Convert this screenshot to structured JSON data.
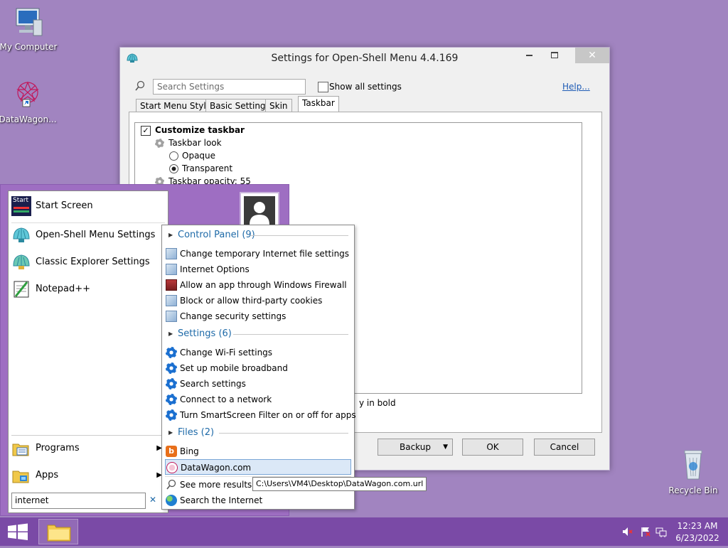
{
  "desktop": {
    "icons": [
      {
        "label": "My Computer"
      },
      {
        "label": "DataWagon..."
      },
      {
        "label": "Recycle Bin"
      }
    ]
  },
  "settings_window": {
    "title": "Settings for Open-Shell Menu 4.4.169",
    "controls": {
      "minimize": "▭",
      "maximize": "☐",
      "close": "✕"
    },
    "search_placeholder": "Search Settings",
    "show_all_label": "Show all settings",
    "help_link": "Help...",
    "tabs": [
      {
        "label": "Start Menu Style"
      },
      {
        "label": "Basic Settings"
      },
      {
        "label": "Skin"
      },
      {
        "label": "Taskbar",
        "active": true
      }
    ],
    "options": {
      "customize_taskbar": "Customize taskbar",
      "taskbar_look": "Taskbar look",
      "opaque": "Opaque",
      "transparent": "Transparent",
      "taskbar_opacity": "Taskbar opacity: 55"
    },
    "bold_note_fragment": "y in bold",
    "buttons": {
      "backup": "Backup",
      "ok": "OK",
      "cancel": "Cancel"
    }
  },
  "start_menu": {
    "items": [
      {
        "label": "Start Screen"
      },
      {
        "label": "Open-Shell Menu Settings"
      },
      {
        "label": "Classic Explorer Settings"
      },
      {
        "label": "Notepad++"
      }
    ],
    "bottom_items": [
      {
        "label": "Programs"
      },
      {
        "label": "Apps"
      }
    ],
    "search_value": "internet",
    "clear_icon": "✕",
    "start_screen_tile_text": "Start"
  },
  "search_results": {
    "groups": [
      {
        "title": "Control Panel (9)",
        "items": [
          {
            "label": "Change temporary Internet file settings"
          },
          {
            "label": "Internet Options"
          },
          {
            "label": "Allow an app through Windows Firewall"
          },
          {
            "label": "Block or allow third-party cookies"
          },
          {
            "label": "Change security settings"
          }
        ]
      },
      {
        "title": "Settings (6)",
        "items": [
          {
            "label": "Change Wi-Fi settings"
          },
          {
            "label": "Set up mobile broadband"
          },
          {
            "label": "Search settings"
          },
          {
            "label": "Connect to a network"
          },
          {
            "label": "Turn SmartScreen Filter on or off for apps"
          }
        ]
      },
      {
        "title": "Files (2)",
        "items": [
          {
            "label": "Bing"
          },
          {
            "label": "DataWagon.com"
          }
        ]
      }
    ],
    "see_more": "See more results",
    "search_internet": "Search the Internet",
    "tooltip": "C:\\Users\\VM4\\Desktop\\DataWagon.com.url"
  },
  "taskbar": {
    "time": "12:23 AM",
    "date": "6/23/2022"
  },
  "colors": {
    "desktop": "#a184c0",
    "start_menu_frame": "#9e6ec2",
    "taskbar": "#7a4aa6",
    "link_blue": "#1e6aa8"
  }
}
